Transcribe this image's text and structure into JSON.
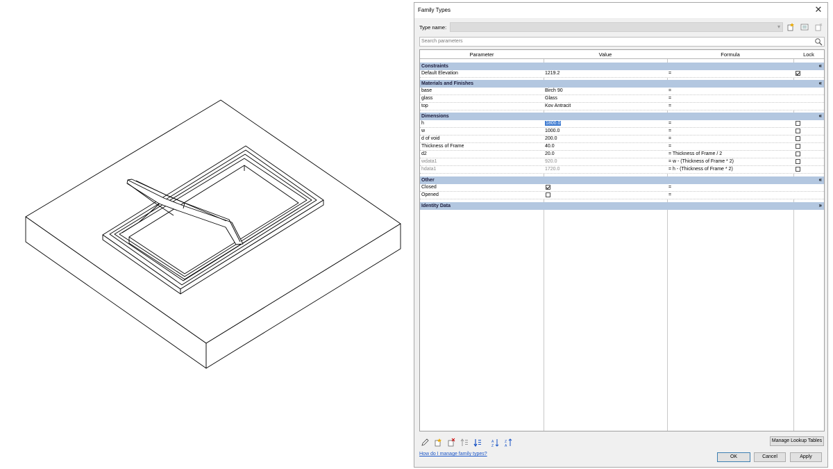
{
  "dialog": {
    "title": "Family Types",
    "close_glyph": "✕",
    "type_name_label": "Type name:",
    "type_name_value": "",
    "search_placeholder": "Search parameters",
    "columns": {
      "parameter": "Parameter",
      "value": "Value",
      "formula": "Formula",
      "lock": "Lock"
    },
    "groups": [
      {
        "name": "Constraints",
        "expanded": true,
        "rows": [
          {
            "parameter": "Default Elevation",
            "value": "1219.2",
            "formula": "=",
            "lock": "checked"
          }
        ]
      },
      {
        "name": "Materials and Finishes",
        "expanded": true,
        "rows": [
          {
            "parameter": "base",
            "value": "Birch 90",
            "formula": "=",
            "lock": "none"
          },
          {
            "parameter": "glass",
            "value": "Glass",
            "formula": "=",
            "lock": "none"
          },
          {
            "parameter": "top",
            "value": "Kov Antracit",
            "formula": "=",
            "lock": "none"
          }
        ]
      },
      {
        "name": "Dimensions",
        "expanded": true,
        "rows": [
          {
            "parameter": "h",
            "value": "1800.0",
            "formula": "=",
            "lock": "unchecked",
            "selected": true
          },
          {
            "parameter": "w",
            "value": "1000.0",
            "formula": "=",
            "lock": "unchecked"
          },
          {
            "parameter": "d of void",
            "value": "200.0",
            "formula": "=",
            "lock": "unchecked"
          },
          {
            "parameter": "Thickness of Frame",
            "value": "40.0",
            "formula": "=",
            "lock": "unchecked"
          },
          {
            "parameter": "d2",
            "value": "20.0",
            "formula": "= Thickness of Frame / 2",
            "lock": "unchecked"
          },
          {
            "parameter": "wdata1",
            "value": "920.0",
            "formula": "= w - (Thickness of Frame * 2)",
            "lock": "unchecked",
            "dim": true
          },
          {
            "parameter": "hdata1",
            "value": "1720.0",
            "formula": "= h - (Thickness of Frame * 2)",
            "lock": "unchecked",
            "dim": true
          }
        ]
      },
      {
        "name": "Other",
        "expanded": true,
        "rows": [
          {
            "parameter": "Closed",
            "value_checkbox": "checked",
            "formula": "=",
            "lock": "none"
          },
          {
            "parameter": "Opened",
            "value_checkbox": "unchecked",
            "formula": "=",
            "lock": "none"
          }
        ]
      },
      {
        "name": "Identity Data",
        "expanded": false,
        "rows": []
      }
    ],
    "toolbar_icons": [
      "edit-pencil-icon",
      "new-parameter-icon",
      "delete-parameter-icon",
      "move-up-icon",
      "move-down-icon",
      "sort-ascending-icon",
      "sort-descending-icon"
    ],
    "manage_lookup_label": "Manage Lookup Tables",
    "help_link": "How do I manage family types?",
    "ok_label": "OK",
    "cancel_label": "Cancel",
    "apply_label": "Apply",
    "colors": {
      "group_band": "#b3c7e0",
      "selection": "#3a78d0",
      "link": "#1a55c6"
    }
  }
}
